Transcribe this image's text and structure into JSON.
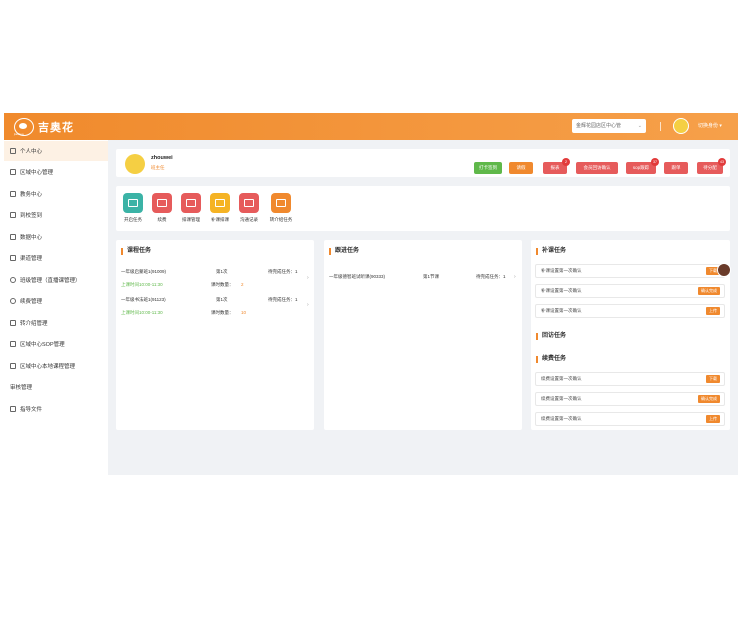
{
  "header": {
    "logo_text": "吉奥花",
    "logo_sub": "jiaohua",
    "campus_selector": "金辉花园店区中心管",
    "user_switch": "切换身份",
    "colors": {
      "brand": "#f0892e",
      "green": "#5fb84a",
      "red": "#e65b5b",
      "teal": "#3bb3a6",
      "yellow": "#f5b324"
    }
  },
  "sidebar": {
    "items": [
      {
        "label": "个人中心",
        "icon": "user-icon"
      },
      {
        "label": "区域中心管理",
        "icon": "user-icon"
      },
      {
        "label": "教务中心",
        "icon": "user-icon"
      },
      {
        "label": "到校签到",
        "icon": "home-icon"
      },
      {
        "label": "数据中心",
        "icon": "mail-icon"
      },
      {
        "label": "渠道管理",
        "icon": "grid-icon"
      },
      {
        "label": "班级管理（直播课管理）",
        "icon": "clock-icon"
      },
      {
        "label": "续费管理",
        "icon": "plus-circle-icon"
      },
      {
        "label": "转介绍管理",
        "icon": "share-icon"
      },
      {
        "label": "区域中心SOP管理",
        "icon": "user-icon"
      },
      {
        "label": "区域中心本地课程管理",
        "icon": "user-icon"
      },
      {
        "label": "审核管理",
        "icon": ""
      },
      {
        "label": "指导文件",
        "icon": "grid-icon"
      }
    ]
  },
  "profile": {
    "name": "zhouwei",
    "role": "班主任",
    "buttons": [
      {
        "label": "打卡签到",
        "badge": ""
      },
      {
        "label": "请假",
        "badge": ""
      },
      {
        "label": "报表",
        "badge": "2"
      },
      {
        "label": "会员回访确认",
        "badge": ""
      },
      {
        "label": "sop跟踪",
        "badge": "37"
      },
      {
        "label": "跟单",
        "badge": ""
      },
      {
        "label": "待分配",
        "badge": "43"
      }
    ]
  },
  "quick_links": [
    {
      "label": "开启任务",
      "icon": "calendar-icon"
    },
    {
      "label": "续费",
      "icon": "wallet-icon"
    },
    {
      "label": "排课管理",
      "icon": "users-icon"
    },
    {
      "label": "补课排课",
      "icon": "mail-icon"
    },
    {
      "label": "沟通记录",
      "icon": "people-icon"
    },
    {
      "label": "转介绍任务",
      "icon": "link-icon"
    }
  ],
  "schedule_panel": {
    "title": "课程任务",
    "rows": [
      {
        "name": "一年级启蒙班1(91009)",
        "lesson": "第1次",
        "deadline_label": "待完成任务：1",
        "time": "上课时间10:00-11:30",
        "count_label": "课时数量：",
        "count": "2"
      },
      {
        "name": "一年级书法班1(91123)",
        "lesson": "第1次",
        "deadline_label": "待完成任务：1",
        "time": "上课时间10:00-11:30",
        "count_label": "课时数量：",
        "count": "10"
      }
    ]
  },
  "followup_panel": {
    "title": "跟进任务",
    "rows": [
      {
        "name": "一年级德智班试听课(90333)",
        "lesson": "第1节课",
        "deadline_label": "待完成任务：1"
      }
    ]
  },
  "right_panel": {
    "makeup_title": "补课任务",
    "makeup_tasks": [
      {
        "text": "补课设置第一次确认",
        "tag": "下载"
      },
      {
        "text": "补课设置第一次确认",
        "tag": "确认完成"
      },
      {
        "text": "补课设置第一次确认",
        "tag": "上传"
      }
    ],
    "report_title": "回访任务",
    "renew_title": "续费任务",
    "renew_tasks": [
      {
        "text": "续费设置第一次确认",
        "tag": "下载"
      },
      {
        "text": "续费设置第一次确认",
        "tag": "确认完成"
      },
      {
        "text": "续费设置第一次确认",
        "tag": "上传"
      }
    ]
  }
}
